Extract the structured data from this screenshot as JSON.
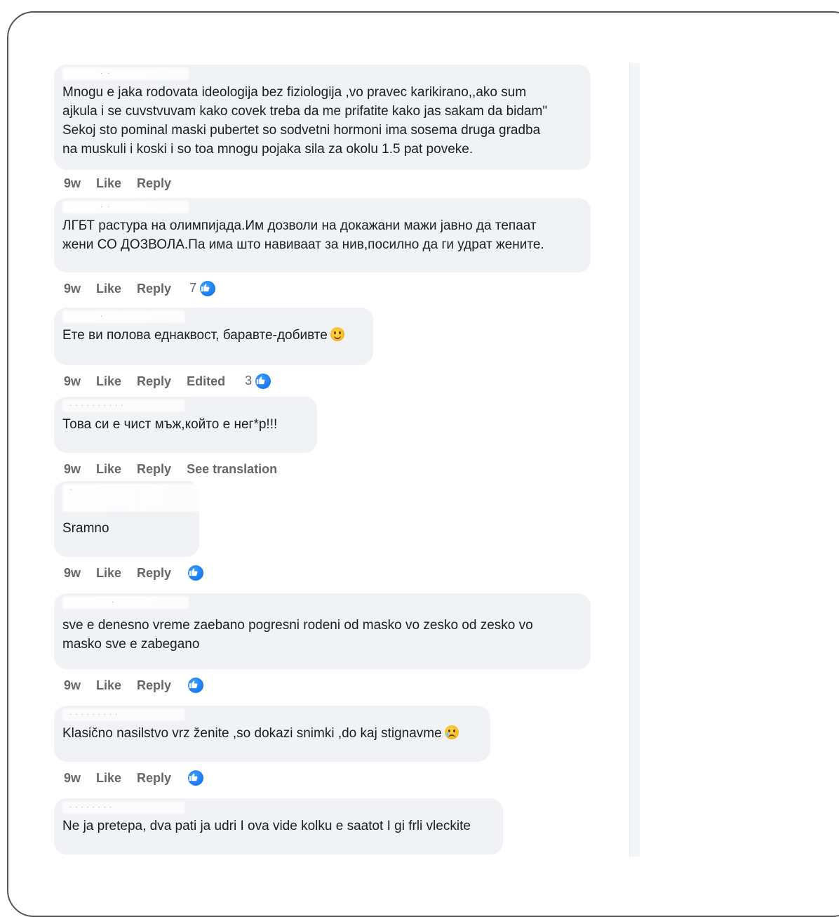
{
  "comments": [
    {
      "text": "Mnogu e jaka rodovata ideologija bez fiziologija ,vo pravec karikirano,,ako sum\najkula i se cuvstvuvam kako covek treba da me prifatite kako jas sakam da bidam\"\nSekoj sto pominal maski pubertet so sodvetni hormoni ima sosema druga gradba\nna muskuli i koski i so toa mnogu pojaka sila za okolu 1.5 pat poveke.",
      "time": "9w",
      "like": "Like",
      "reply": "Reply"
    },
    {
      "text": "ЛГБТ растура на олимпијада.Им дозволи на докажани мажи јавно да тепаат\nжени СО ДОЗВОЛА.Па има што навиваат за нив,посилно да ги удрат жените.",
      "time": "9w",
      "like": "Like",
      "reply": "Reply",
      "reactions": "7"
    },
    {
      "text": "Ете ви полова еднаквост, баравте-добивте",
      "time": "9w",
      "like": "Like",
      "reply": "Reply",
      "edited": "Edited",
      "reactions": "3"
    },
    {
      "text": "Това си е чист мъж,който е нег*р!!!",
      "time": "9w",
      "like": "Like",
      "reply": "Reply",
      "see_translation": "See translation"
    },
    {
      "text": "Sramno",
      "time": "9w",
      "like": "Like",
      "reply": "Reply"
    },
    {
      "text": "sve e denesno vreme zaebano pogresni rodeni od masko vo zesko od zesko vo\nmasko sve e zabegano",
      "time": "9w",
      "like": "Like",
      "reply": "Reply"
    },
    {
      "text": "Klasično nasilstvo vrz ženite ,so dokazi snimki ,do kaj stignavme",
      "time": "9w",
      "like": "Like",
      "reply": "Reply"
    },
    {
      "text": "Ne ja pretepa, dva pati ja udri I ova vide kolku e saatot I gi frli vleckite"
    }
  ]
}
